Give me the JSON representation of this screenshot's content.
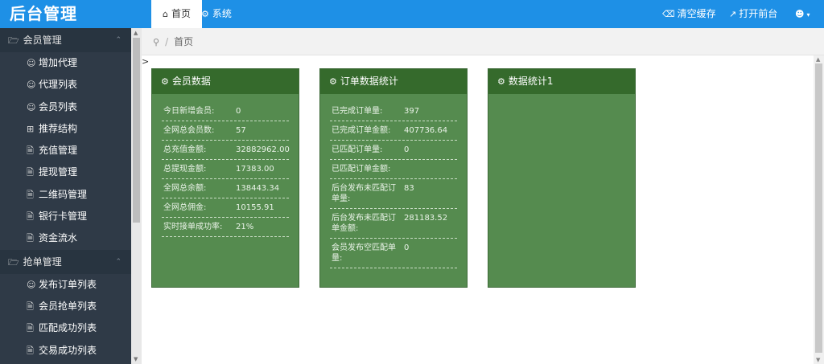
{
  "app": {
    "title": "后台管理"
  },
  "top_tabs": [
    {
      "label": "首页",
      "icon": "home-icon"
    },
    {
      "label": "系统",
      "icon": "gear-icon"
    }
  ],
  "top_actions": {
    "clear_cache": "清空缓存",
    "open_frontend": "打开前台",
    "user_icon": "user-icon"
  },
  "sidebar": {
    "groups": [
      {
        "label": "会员管理",
        "icon": "folder-icon",
        "items": [
          {
            "label": "增加代理",
            "icon": "user-icon"
          },
          {
            "label": "代理列表",
            "icon": "user-icon"
          },
          {
            "label": "会员列表",
            "icon": "user-icon"
          },
          {
            "label": "推荐结构",
            "icon": "grid-icon"
          },
          {
            "label": "充值管理",
            "icon": "file-icon"
          },
          {
            "label": "提现管理",
            "icon": "file-icon"
          },
          {
            "label": "二维码管理",
            "icon": "file-icon"
          },
          {
            "label": "银行卡管理",
            "icon": "file-icon"
          },
          {
            "label": "资金流水",
            "icon": "file-icon"
          }
        ]
      },
      {
        "label": "抢单管理",
        "icon": "folder-icon",
        "items": [
          {
            "label": "发布订单列表",
            "icon": "user-icon"
          },
          {
            "label": "会员抢单列表",
            "icon": "file-icon"
          },
          {
            "label": "匹配成功列表",
            "icon": "file-icon"
          },
          {
            "label": "交易成功列表",
            "icon": "file-icon"
          }
        ]
      }
    ]
  },
  "breadcrumb": {
    "current": "首页"
  },
  "cards": [
    {
      "title": "会员数据",
      "rows": [
        {
          "label": "今日新增会员:",
          "value": "0"
        },
        {
          "label": "全网总会员数:",
          "value": "57"
        },
        {
          "label": "总充值金额:",
          "value": "32882962.00"
        },
        {
          "label": "总提现金额:",
          "value": "17383.00"
        },
        {
          "label": "全网总余额:",
          "value": "138443.34"
        },
        {
          "label": "全网总佣金:",
          "value": "10155.91"
        },
        {
          "label": "实时接单成功率:",
          "value": "21%"
        }
      ]
    },
    {
      "title": "订单数据统计",
      "rows": [
        {
          "label": "已完成订单量:",
          "value": "397"
        },
        {
          "label": "已完成订单金额:",
          "value": "407736.64"
        },
        {
          "label": "已匹配订单量:",
          "value": "0"
        },
        {
          "label": "已匹配订单金额:",
          "value": ""
        },
        {
          "label": "后台发布未匹配订单量:",
          "value": "83"
        },
        {
          "label": "后台发布未匹配订单金额:",
          "value": "281183.52"
        },
        {
          "label": "会员发布空匹配单量:",
          "value": "0"
        }
      ]
    },
    {
      "title": "数据统计1",
      "rows": []
    }
  ],
  "colors": {
    "topbar": "#1e90e6",
    "sidebar": "#2f3a47",
    "card_body": "#558b4f",
    "card_head": "#356a2c"
  }
}
